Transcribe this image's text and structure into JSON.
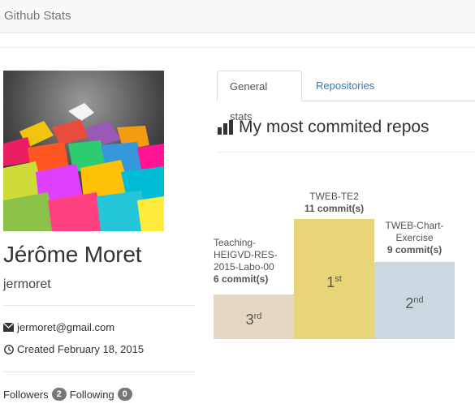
{
  "app": {
    "brand": "Github Stats"
  },
  "user": {
    "name": "Jérôme Moret",
    "login": "jermoret",
    "email": "jermoret@gmail.com",
    "created": "Created February 18, 2015",
    "followers_label": "Followers",
    "followers_count": "2",
    "following_label": "Following",
    "following_count": "0"
  },
  "tabs": [
    {
      "label": "General stats",
      "active": true
    },
    {
      "label": "Repositories",
      "active": false
    }
  ],
  "section": {
    "title": "My most commited repos",
    "icon": "bar-chart-icon"
  },
  "podium": {
    "first": {
      "repo": "TWEB-TE2",
      "commits": "11 commit(s)",
      "rank_num": "1",
      "rank_suffix": "st",
      "color": "#e8d57a"
    },
    "second": {
      "repo": "TWEB-Chart-Exercise",
      "repo_lines": [
        "TWEB-Chart-",
        "Exercise"
      ],
      "commits": "9 commit(s)",
      "rank_num": "2",
      "rank_suffix": "nd",
      "color": "#ccd8e0"
    },
    "third": {
      "repo": "Teaching-HEIGVD-RES-2015-Labo-00",
      "repo_lines": [
        "Teaching-",
        "HEIGVD-RES-",
        "2015-Labo-00"
      ],
      "commits": "6 commit(s)",
      "rank_num": "3",
      "rank_suffix": "rd",
      "color": "#e6d7c3"
    }
  }
}
